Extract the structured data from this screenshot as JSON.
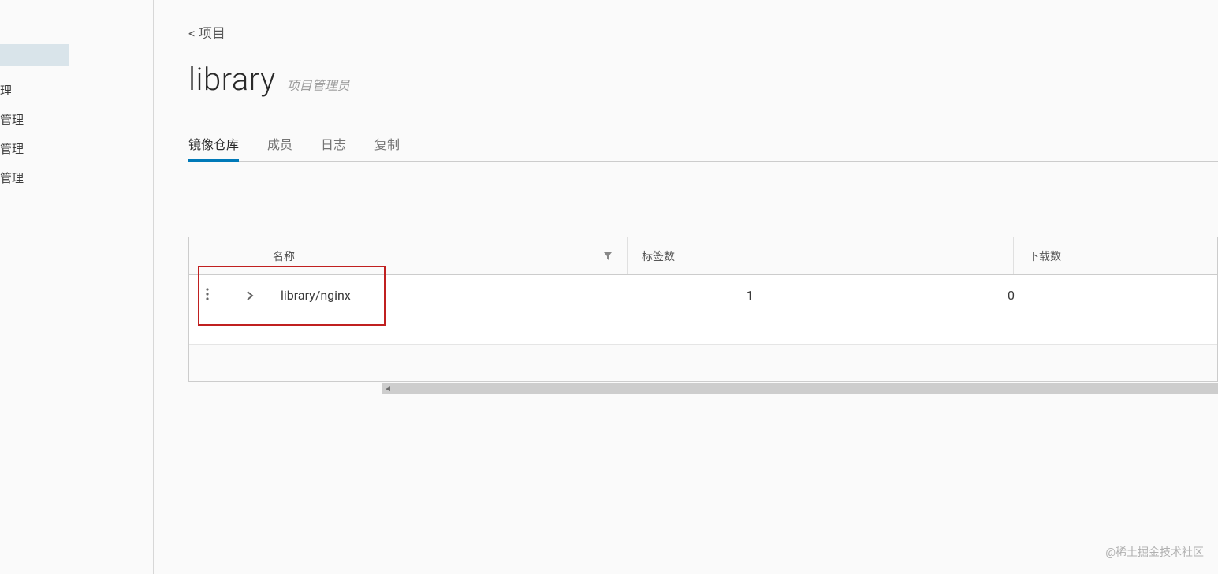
{
  "sidebar": {
    "items": [
      {
        "label": "理"
      },
      {
        "label": "管理"
      },
      {
        "label": "管理"
      },
      {
        "label": "管理"
      }
    ]
  },
  "breadcrumb": {
    "back_label": "< 项目"
  },
  "header": {
    "title": "library",
    "role": "项目管理员"
  },
  "tabs": [
    {
      "label": "镜像仓库",
      "active": true
    },
    {
      "label": "成员",
      "active": false
    },
    {
      "label": "日志",
      "active": false
    },
    {
      "label": "复制",
      "active": false
    }
  ],
  "table": {
    "columns": {
      "name": "名称",
      "tags": "标签数",
      "downloads": "下载数"
    },
    "rows": [
      {
        "name": "library/nginx",
        "tags": "1",
        "downloads": "0"
      }
    ]
  },
  "watermark": "@稀土掘金技术社区"
}
